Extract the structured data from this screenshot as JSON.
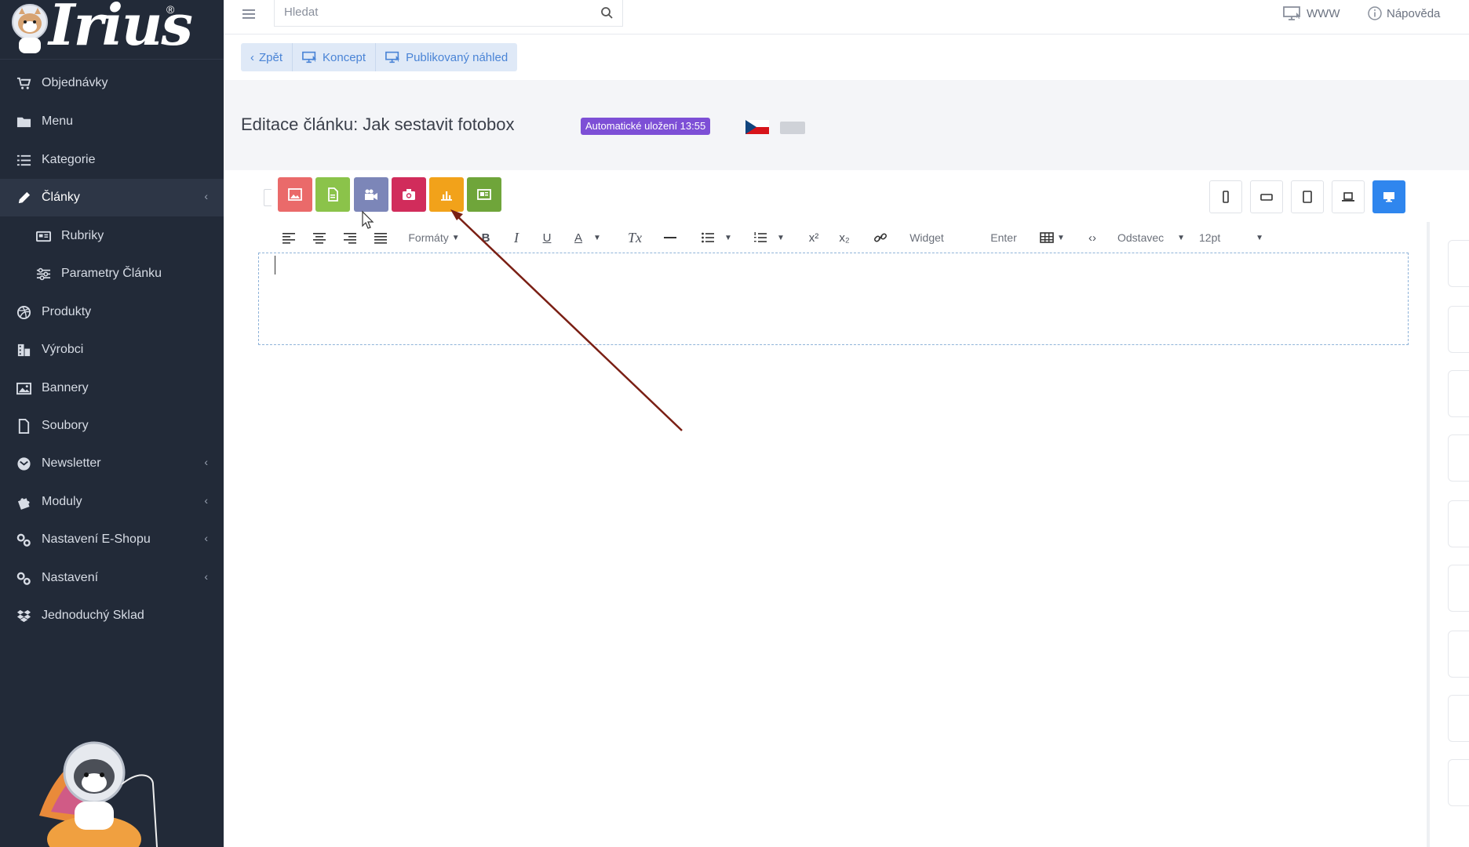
{
  "brand": {
    "wordmark": "Irius",
    "registered": "®"
  },
  "search": {
    "placeholder": "Hledat"
  },
  "topbar": {
    "www_label": "WWW",
    "help_label": "Nápověda"
  },
  "actions": [
    {
      "label": "Zpět",
      "icon": "chevron-left-icon"
    },
    {
      "label": "Koncept",
      "icon": "monitor-icon"
    },
    {
      "label": "Publikovaný náhled",
      "icon": "monitor-icon"
    }
  ],
  "sidebar": {
    "items": [
      {
        "label": "Objednávky",
        "icon": "cart-icon"
      },
      {
        "label": "Menu",
        "icon": "folder-icon"
      },
      {
        "label": "Kategorie",
        "icon": "list-icon"
      },
      {
        "label": "Články",
        "icon": "pencil-icon",
        "active": true,
        "chevron": "‹"
      },
      {
        "label": "Rubriky",
        "icon": "newspaper-icon",
        "sub": true
      },
      {
        "label": "Parametry Článku",
        "icon": "sliders-icon",
        "sub": true
      },
      {
        "label": "Produkty",
        "icon": "dribbble-icon"
      },
      {
        "label": "Výrobci",
        "icon": "building-icon"
      },
      {
        "label": "Bannery",
        "icon": "image-icon"
      },
      {
        "label": "Soubory",
        "icon": "file-icon"
      },
      {
        "label": "Newsletter",
        "icon": "at-icon",
        "chevron": "‹"
      },
      {
        "label": "Moduly",
        "icon": "puzzle-icon",
        "chevron": "‹"
      },
      {
        "label": "Nastavení E-Shopu",
        "icon": "cogs-icon",
        "chevron": "‹"
      },
      {
        "label": "Nastavení",
        "icon": "cogs-icon",
        "chevron": "‹"
      },
      {
        "label": "Jednoduchý Sklad",
        "icon": "dropbox-icon"
      }
    ]
  },
  "page": {
    "title": "Editace článku:  Jak sestavit fotobox",
    "autosave_badge": "Automatické uložení 13:55"
  },
  "widgets": [
    {
      "name": "image-widget",
      "color": "#ea6a6a"
    },
    {
      "name": "document-widget",
      "color": "#8bc34a"
    },
    {
      "name": "video-widget",
      "color": "#7c86b8"
    },
    {
      "name": "gallery-widget",
      "color": "#d12c5b"
    },
    {
      "name": "chart-widget",
      "color": "#f2a21a"
    },
    {
      "name": "card-widget",
      "color": "#6fa53a"
    }
  ],
  "toolbar": {
    "formats_label": "Formáty",
    "widget_label": "Widget",
    "enter_label": "Enter",
    "block_label": "Odstavec",
    "size_label": "12pt"
  },
  "colors": {
    "sidebar_bg": "#222a38",
    "accent": "#2f86ee",
    "badge": "#7d4fd6",
    "arrow": "#7a1f14"
  }
}
